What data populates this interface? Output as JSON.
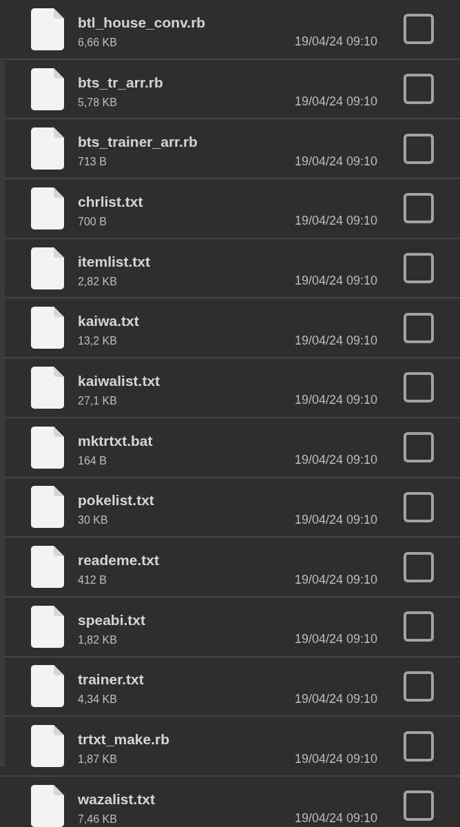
{
  "scrollbar": {
    "visible": true
  },
  "files": [
    {
      "name": "btl_house_conv.rb",
      "size": "6,66 KB",
      "modified": "19/04/24 09:10",
      "checked": false
    },
    {
      "name": "bts_tr_arr.rb",
      "size": "5,78 KB",
      "modified": "19/04/24 09:10",
      "checked": false
    },
    {
      "name": "bts_trainer_arr.rb",
      "size": "713 B",
      "modified": "19/04/24 09:10",
      "checked": false
    },
    {
      "name": "chrlist.txt",
      "size": "700 B",
      "modified": "19/04/24 09:10",
      "checked": false
    },
    {
      "name": "itemlist.txt",
      "size": "2,82 KB",
      "modified": "19/04/24 09:10",
      "checked": false
    },
    {
      "name": "kaiwa.txt",
      "size": "13,2 KB",
      "modified": "19/04/24 09:10",
      "checked": false
    },
    {
      "name": "kaiwalist.txt",
      "size": "27,1 KB",
      "modified": "19/04/24 09:10",
      "checked": false
    },
    {
      "name": "mktrtxt.bat",
      "size": "164 B",
      "modified": "19/04/24 09:10",
      "checked": false
    },
    {
      "name": "pokelist.txt",
      "size": "30 KB",
      "modified": "19/04/24 09:10",
      "checked": false
    },
    {
      "name": "reademe.txt",
      "size": "412 B",
      "modified": "19/04/24 09:10",
      "checked": false
    },
    {
      "name": "speabi.txt",
      "size": "1,82 KB",
      "modified": "19/04/24 09:10",
      "checked": false
    },
    {
      "name": "trainer.txt",
      "size": "4,34 KB",
      "modified": "19/04/24 09:10",
      "checked": false
    },
    {
      "name": "trtxt_make.rb",
      "size": "1,87 KB",
      "modified": "19/04/24 09:10",
      "checked": false
    },
    {
      "name": "wazalist.txt",
      "size": "7,46 KB",
      "modified": "19/04/24 09:10",
      "checked": false
    }
  ]
}
